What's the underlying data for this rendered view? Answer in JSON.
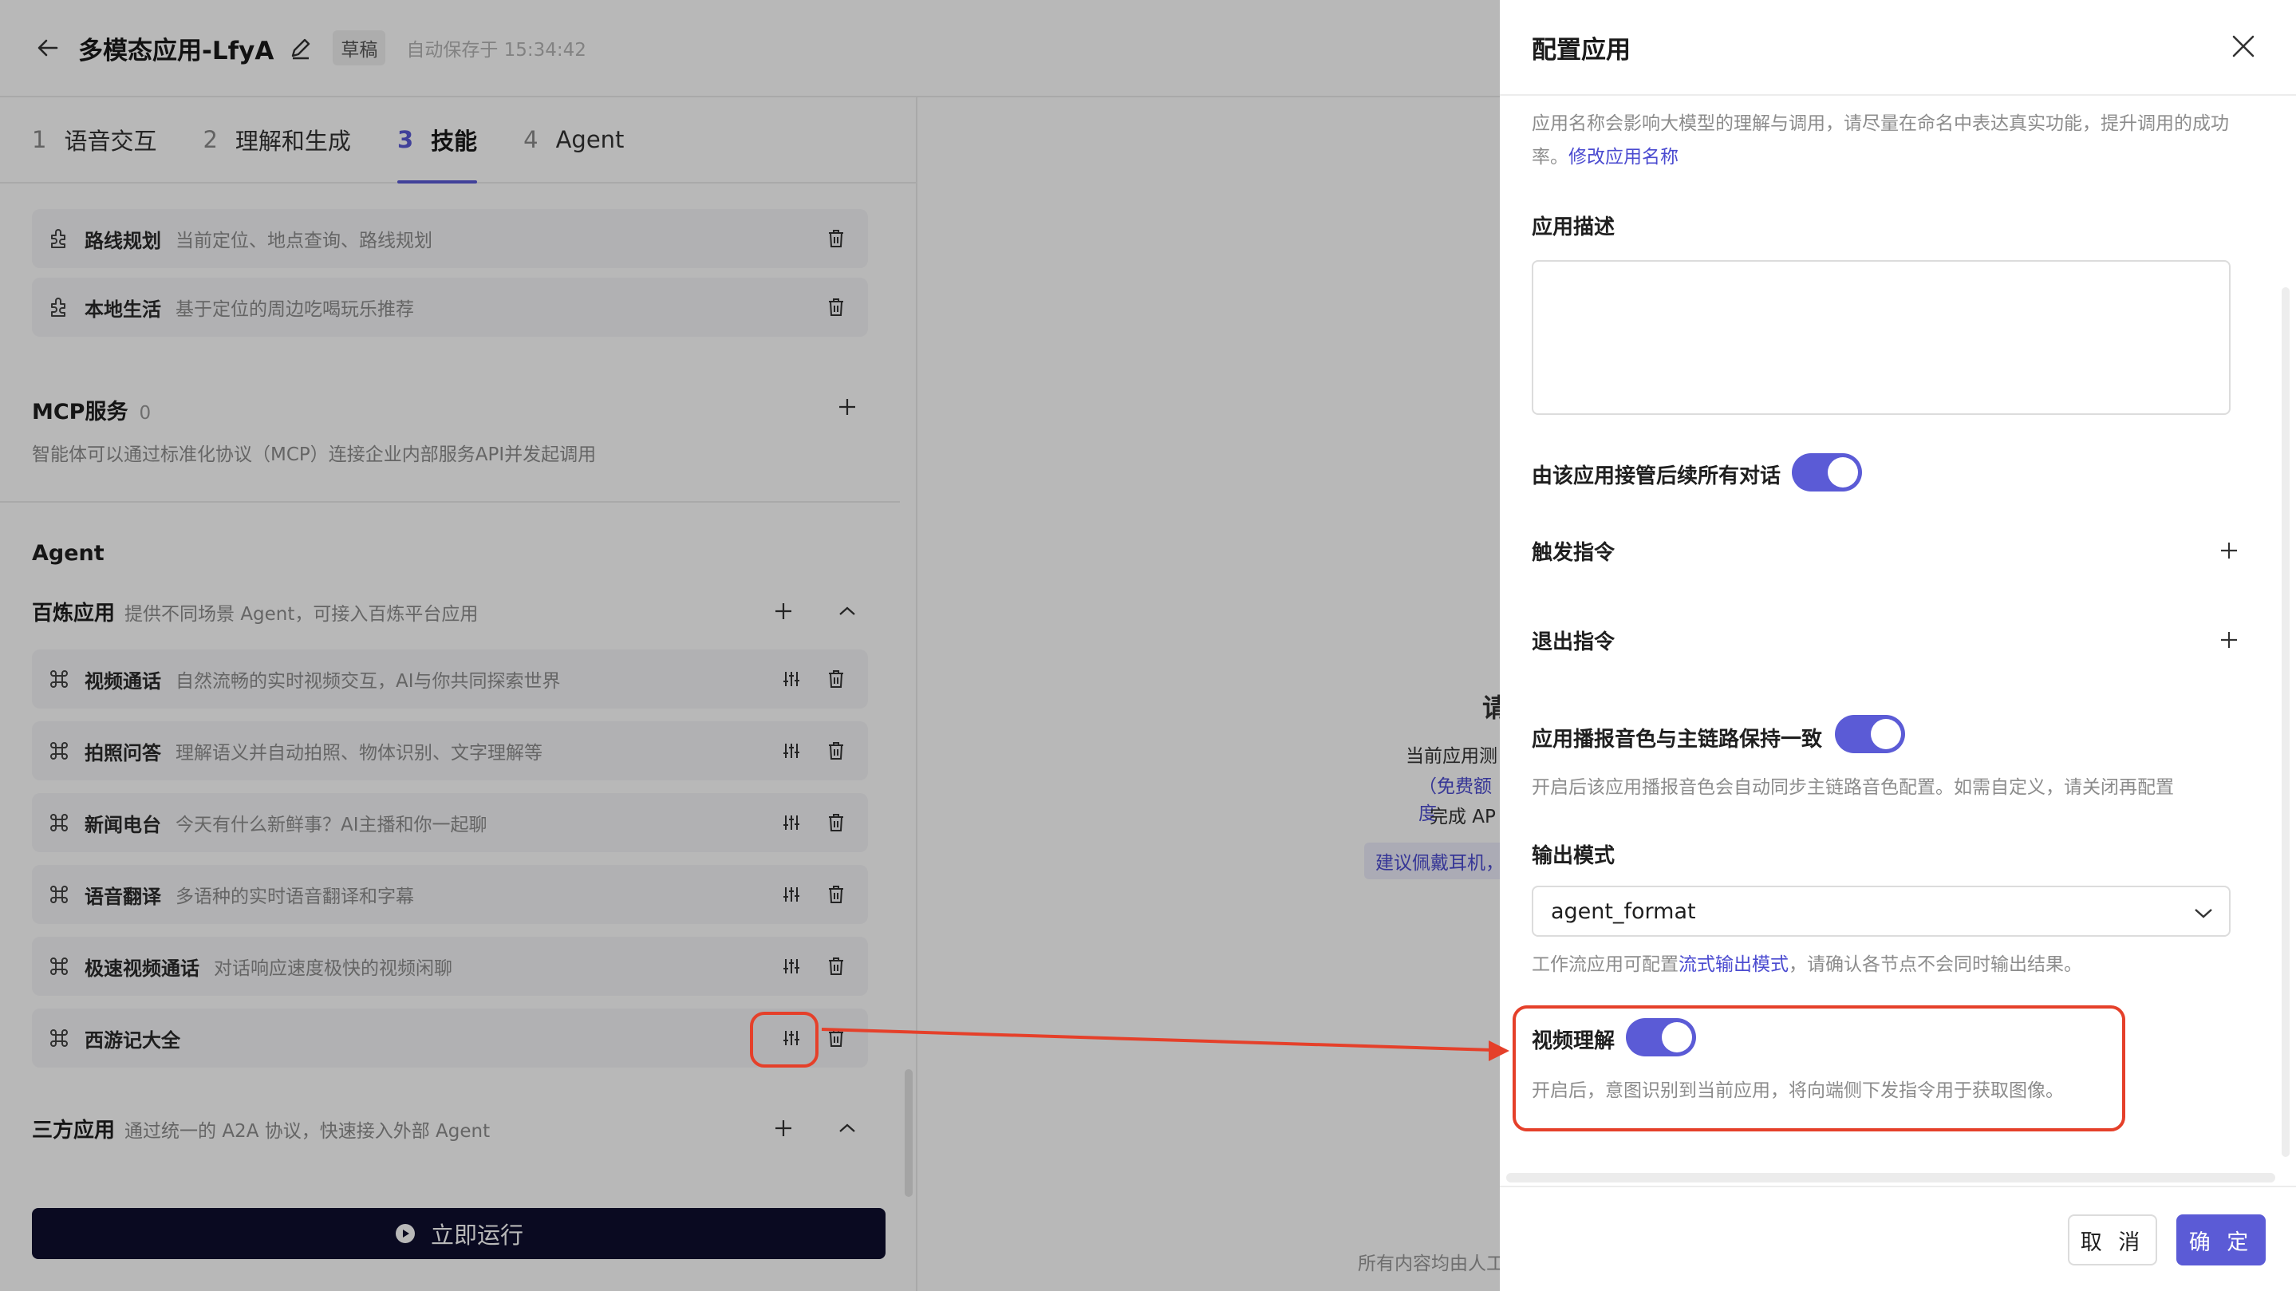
{
  "header": {
    "app_title": "多模态应用-LfyA",
    "draft_badge": "草稿",
    "autosave": "自动保存于 15:34:42"
  },
  "tabs": [
    {
      "num": "1",
      "label": "语音交互"
    },
    {
      "num": "2",
      "label": "理解和生成"
    },
    {
      "num": "3",
      "label": "技能"
    },
    {
      "num": "4",
      "label": "Agent"
    }
  ],
  "plugins": [
    {
      "name": "路线规划",
      "desc": "当前定位、地点查询、路线规划"
    },
    {
      "name": "本地生活",
      "desc": "基于定位的周边吃喝玩乐推荐"
    }
  ],
  "mcp": {
    "title": "MCP服务",
    "count": "0",
    "desc": "智能体可以通过标准化协议（MCP）连接企业内部服务API并发起调用"
  },
  "agent": {
    "title": "Agent",
    "bailian": {
      "name": "百炼应用",
      "desc": "提供不同场景 Agent，可接入百炼平台应用",
      "items": [
        {
          "name": "视频通话",
          "desc": "自然流畅的实时视频交互，AI与你共同探索世界"
        },
        {
          "name": "拍照问答",
          "desc": "理解语义并自动拍照、物体识别、文字理解等"
        },
        {
          "name": "新闻电台",
          "desc": "今天有什么新鲜事？AI主播和你一起聊"
        },
        {
          "name": "语音翻译",
          "desc": "多语种的实时语音翻译和字幕"
        },
        {
          "name": "极速视频通话",
          "desc": "对话响应速度极快的视频闲聊"
        },
        {
          "name": "西游记大全",
          "desc": ""
        }
      ]
    },
    "third_party": {
      "name": "三方应用",
      "desc": "通过统一的 A2A 协议，快速接入外部 Agent"
    }
  },
  "run_button": "立即运行",
  "center": {
    "heading_char": "请",
    "line1": "当前应用测",
    "line2": "（免费额度",
    "line3": "完成 AP",
    "tag": "建议佩戴耳机，",
    "footer": "所有内容均由人工"
  },
  "drawer": {
    "title": "配置应用",
    "name_hint": "应用名称会影响大模型的理解与调用，请尽量在命名中表达真实功能，提升调用的成功率。",
    "name_link": "修改应用名称",
    "desc_label": "应用描述",
    "takeover_label": "由该应用接管后续所有对话",
    "trigger_label": "触发指令",
    "exit_label": "退出指令",
    "voice_label": "应用播报音色与主链路保持一致",
    "voice_hint": "开启后该应用播报音色会自动同步主链路音色配置。如需自定义，请关闭再配置",
    "output_label": "输出模式",
    "output_value": "agent_format",
    "output_hint_pre": "工作流应用可配置",
    "output_hint_link": "流式输出模式",
    "output_hint_post": "，请确认各节点不会同时输出结果。",
    "video_label": "视频理解",
    "video_hint": "开启后，意图识别到当前应用，将向端侧下发指令用于获取图像。",
    "cancel": "取 消",
    "ok": "确 定"
  },
  "colors": {
    "accent": "#5b5bd6",
    "annotation": "#e5402a",
    "run_button": "#0f0f2e"
  }
}
